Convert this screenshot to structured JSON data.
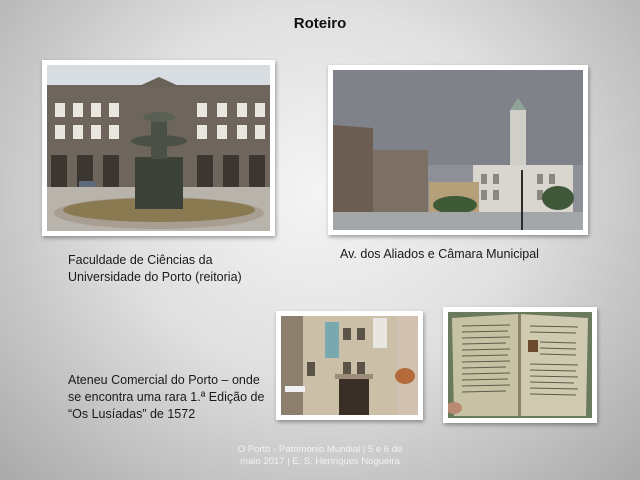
{
  "slide": {
    "title": "Roteiro",
    "captions": {
      "faculdade_line1": "Faculdade de Ciências da",
      "faculdade_line2": "Universidade do Porto (reitoria)",
      "aliados": "Av. dos Aliados e Câmara Municipal",
      "ateneu_line1": "Ateneu Comercial do Porto – onde",
      "ateneu_line2": "se encontra uma rara 1.ª Edição de",
      "ateneu_line3": "“Os Lusíadas” de 1572"
    },
    "footer": {
      "line1": "O Porto - Património Mundial | 5 e 6 de",
      "line2": "maio 2017 | E. S. Henriques Nogueira"
    }
  }
}
